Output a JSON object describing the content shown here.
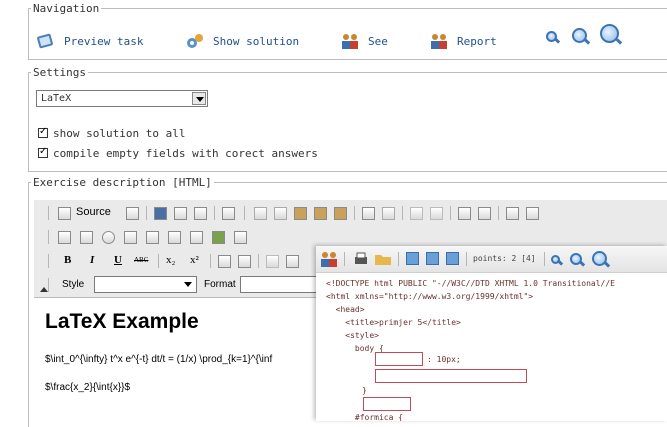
{
  "navigation": {
    "legend": "Navigation",
    "preview_label": "Preview task",
    "show_solution_label": "Show solution",
    "see_label": "See",
    "report_label": "Report"
  },
  "settings": {
    "legend": "Settings",
    "format_selected": "LaTeX",
    "show_solution_label": "show solution to all",
    "compile_label": "compile empty fields with corect answers"
  },
  "exercise": {
    "legend": "Exercise description [HTML]",
    "toolbar": {
      "source_label": "Source",
      "bold": "B",
      "italic": "I",
      "underline": "U",
      "abc": "ABC",
      "style_label": "Style",
      "format_label": "Format"
    },
    "content": {
      "heading": "LaTeX Example",
      "line1": "$\\int_0^{\\infty} t^x e^{-t} dt/t = (1/x) \\prod_{k=1}^{\\inf",
      "line2": "$\\frac{x_2}{\\int{x}}$"
    }
  },
  "overlay": {
    "points_label": "points: 2 [4]",
    "code_lines": [
      "<!DOCTYPE html PUBLIC \"-//W3C//DTD XHTML 1.0 Transitional//E",
      "<html xmlns=\"http://www.w3.org/1999/xhtml\">",
      "  <head>",
      "    <title>primjer 5</title>",
      "    <style>",
      "      body {",
      ": 10px;",
      "}",
      "      #formica {"
    ]
  },
  "colors": {
    "link_blue": "#1f4f8f",
    "code_brown": "#6b2f2f",
    "field_red": "#c14b5b"
  }
}
